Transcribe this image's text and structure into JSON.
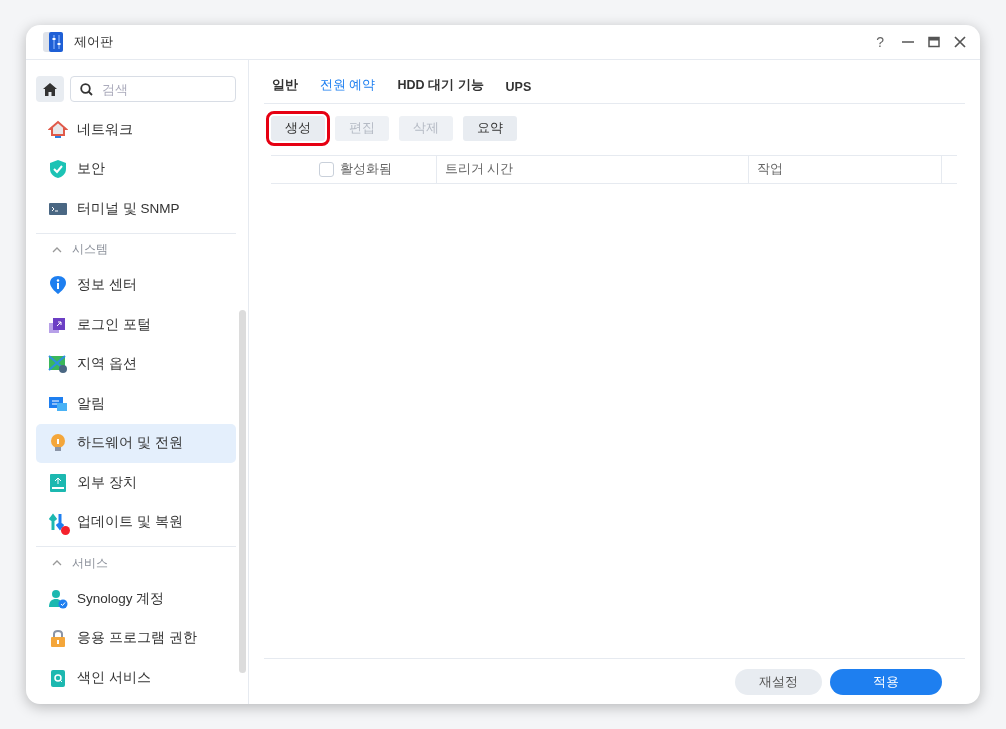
{
  "window": {
    "title": "제어판",
    "help": "?"
  },
  "sidebar": {
    "search": {
      "placeholder": "검색"
    },
    "sections": [
      {
        "items": [
          {
            "label": "네트워크",
            "selected": false,
            "alert": false
          },
          {
            "label": "보안",
            "selected": false,
            "alert": false
          },
          {
            "label": "터미널 및 SNMP",
            "selected": false,
            "alert": false
          }
        ]
      },
      {
        "header": "시스템",
        "expanded": true,
        "items": [
          {
            "label": "정보 센터",
            "selected": false,
            "alert": false
          },
          {
            "label": "로그인 포털",
            "selected": false,
            "alert": false
          },
          {
            "label": "지역 옵션",
            "selected": false,
            "alert": false
          },
          {
            "label": "알림",
            "selected": false,
            "alert": false
          },
          {
            "label": "하드웨어 및 전원",
            "selected": true,
            "alert": false
          },
          {
            "label": "외부 장치",
            "selected": false,
            "alert": false
          },
          {
            "label": "업데이트 및 복원",
            "selected": false,
            "alert": true
          }
        ]
      },
      {
        "header": "서비스",
        "expanded": true,
        "items": [
          {
            "label": "Synology 계정",
            "selected": false,
            "alert": false
          },
          {
            "label": "응용 프로그램 권한",
            "selected": false,
            "alert": false
          },
          {
            "label": "색인 서비스",
            "selected": false,
            "alert": false
          }
        ]
      }
    ]
  },
  "tabs": [
    {
      "label": "일반",
      "selected": false
    },
    {
      "label": "전원 예약",
      "selected": true
    },
    {
      "label": "HDD 대기 기능",
      "selected": false
    },
    {
      "label": "UPS",
      "selected": false
    }
  ],
  "toolbar": [
    {
      "label": "생성",
      "disabled": false,
      "highlighted": true
    },
    {
      "label": "편집",
      "disabled": true,
      "highlighted": false
    },
    {
      "label": "삭제",
      "disabled": true,
      "highlighted": false
    },
    {
      "label": "요약",
      "disabled": false,
      "highlighted": false
    }
  ],
  "table": {
    "select_all": {
      "checked": false
    },
    "columns": [
      "활성화됨",
      "트리거 시간",
      "작업"
    ]
  },
  "footer": [
    {
      "label": "재설정",
      "kind": "secondary"
    },
    {
      "label": "적용",
      "kind": "primary"
    }
  ]
}
